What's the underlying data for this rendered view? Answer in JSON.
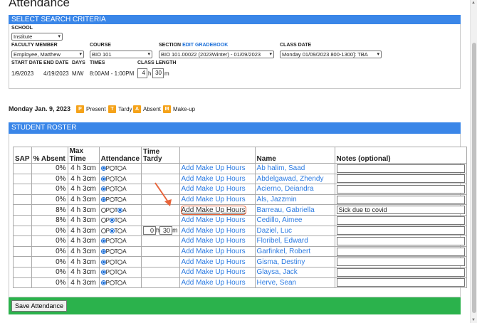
{
  "page": {
    "title": "Attendance"
  },
  "criteria": {
    "header": "SELECT SEARCH CRITERIA",
    "school_label": "SCHOOL",
    "school_value": "Institute",
    "faculty_label": "FACULTY MEMBER",
    "faculty_value": "Employee, Matthew",
    "course_label": "COURSE",
    "course_value": "BIO 101",
    "section_label": "SECTION",
    "edit_gradebook": "EDIT GRADEBOOK",
    "section_value": "BIO 101.00022 (2023Winter) - 01/09/2023",
    "class_date_label": "CLASS DATE",
    "class_date_value": "Monday 01/09/2023 800-1300]: TBA",
    "start_date_label": "START DATE",
    "start_date_value": "1/9/2023",
    "end_date_label": "END DATE",
    "end_date_value": "4/19/2023",
    "days_label": "DAYS",
    "days_value": "M/W",
    "times_label": "TIMES",
    "times_value": "8:00AM - 1:00PM",
    "class_length_label": "CLASS LENGTH",
    "class_length_hours": "4",
    "class_length_h": "h",
    "class_length_minutes": "30",
    "class_length_m": "m"
  },
  "date_line": "Monday Jan. 9, 2023",
  "legend": [
    {
      "key": "P",
      "label": "Present"
    },
    {
      "key": "T",
      "label": "Tardy"
    },
    {
      "key": "A",
      "label": "Absent"
    },
    {
      "key": "M",
      "label": "Make-up"
    }
  ],
  "roster": {
    "header": "STUDENT ROSTER",
    "columns": {
      "sap": "SAP",
      "absent": "% Absent",
      "max_time": "Max Time",
      "attendance": "Attendance",
      "time_tardy": "Time Tardy",
      "makeup": "",
      "name": "Name",
      "notes": "Notes (optional)"
    },
    "makeup_label": "Add Make Up Hours",
    "max_time": "4 h  3cm",
    "rows": [
      {
        "absent": "0%",
        "att": "P",
        "name": "Ab halim, Saad",
        "note": ""
      },
      {
        "absent": "0%",
        "att": "P",
        "name": "Abdelgawad, Zhendy",
        "note": ""
      },
      {
        "absent": "0%",
        "att": "P",
        "name": "Acierno, Deiandra",
        "note": ""
      },
      {
        "absent": "0%",
        "att": "P",
        "name": "Als, Jazzmin",
        "note": ""
      },
      {
        "absent": "8%",
        "att": "A",
        "name": "Barreau, Gabriella",
        "note": "Sick due to covid",
        "highlight": true
      },
      {
        "absent": "8%",
        "att": "T",
        "name": "Cedillo, Aimee",
        "note": ""
      },
      {
        "absent": "0%",
        "att": "T",
        "name": "Daziel, Luc",
        "note": "",
        "tardy_h": "0",
        "tardy_m": "30"
      },
      {
        "absent": "0%",
        "att": "P",
        "name": "Floribel, Edward",
        "note": ""
      },
      {
        "absent": "0%",
        "att": "P",
        "name": "Garfinkel, Robert",
        "note": ""
      },
      {
        "absent": "0%",
        "att": "P",
        "name": "Gisma, Destiny",
        "note": ""
      },
      {
        "absent": "0%",
        "att": "P",
        "name": "Glaysa, Jack",
        "note": ""
      },
      {
        "absent": "0%",
        "att": "P",
        "name": "Herve, Sean",
        "note": ""
      }
    ]
  },
  "save_label": "Save Attendance",
  "colors": {
    "header_blue": "#3a86e8",
    "save_green": "#2bb24c",
    "badge_orange": "#f5a31a",
    "link_blue": "#2a7ae2",
    "callout_red": "#e8643a"
  }
}
